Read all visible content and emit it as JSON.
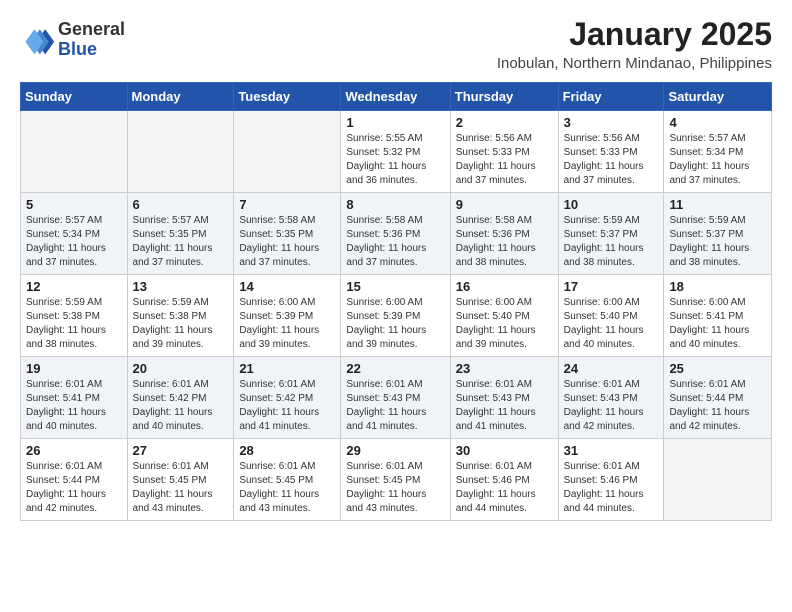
{
  "header": {
    "logo_general": "General",
    "logo_blue": "Blue",
    "month": "January 2025",
    "location": "Inobulan, Northern Mindanao, Philippines"
  },
  "weekdays": [
    "Sunday",
    "Monday",
    "Tuesday",
    "Wednesday",
    "Thursday",
    "Friday",
    "Saturday"
  ],
  "weeks": [
    [
      {
        "day": "",
        "info": ""
      },
      {
        "day": "",
        "info": ""
      },
      {
        "day": "",
        "info": ""
      },
      {
        "day": "1",
        "info": "Sunrise: 5:55 AM\nSunset: 5:32 PM\nDaylight: 11 hours and 36 minutes."
      },
      {
        "day": "2",
        "info": "Sunrise: 5:56 AM\nSunset: 5:33 PM\nDaylight: 11 hours and 37 minutes."
      },
      {
        "day": "3",
        "info": "Sunrise: 5:56 AM\nSunset: 5:33 PM\nDaylight: 11 hours and 37 minutes."
      },
      {
        "day": "4",
        "info": "Sunrise: 5:57 AM\nSunset: 5:34 PM\nDaylight: 11 hours and 37 minutes."
      }
    ],
    [
      {
        "day": "5",
        "info": "Sunrise: 5:57 AM\nSunset: 5:34 PM\nDaylight: 11 hours and 37 minutes."
      },
      {
        "day": "6",
        "info": "Sunrise: 5:57 AM\nSunset: 5:35 PM\nDaylight: 11 hours and 37 minutes."
      },
      {
        "day": "7",
        "info": "Sunrise: 5:58 AM\nSunset: 5:35 PM\nDaylight: 11 hours and 37 minutes."
      },
      {
        "day": "8",
        "info": "Sunrise: 5:58 AM\nSunset: 5:36 PM\nDaylight: 11 hours and 37 minutes."
      },
      {
        "day": "9",
        "info": "Sunrise: 5:58 AM\nSunset: 5:36 PM\nDaylight: 11 hours and 38 minutes."
      },
      {
        "day": "10",
        "info": "Sunrise: 5:59 AM\nSunset: 5:37 PM\nDaylight: 11 hours and 38 minutes."
      },
      {
        "day": "11",
        "info": "Sunrise: 5:59 AM\nSunset: 5:37 PM\nDaylight: 11 hours and 38 minutes."
      }
    ],
    [
      {
        "day": "12",
        "info": "Sunrise: 5:59 AM\nSunset: 5:38 PM\nDaylight: 11 hours and 38 minutes."
      },
      {
        "day": "13",
        "info": "Sunrise: 5:59 AM\nSunset: 5:38 PM\nDaylight: 11 hours and 39 minutes."
      },
      {
        "day": "14",
        "info": "Sunrise: 6:00 AM\nSunset: 5:39 PM\nDaylight: 11 hours and 39 minutes."
      },
      {
        "day": "15",
        "info": "Sunrise: 6:00 AM\nSunset: 5:39 PM\nDaylight: 11 hours and 39 minutes."
      },
      {
        "day": "16",
        "info": "Sunrise: 6:00 AM\nSunset: 5:40 PM\nDaylight: 11 hours and 39 minutes."
      },
      {
        "day": "17",
        "info": "Sunrise: 6:00 AM\nSunset: 5:40 PM\nDaylight: 11 hours and 40 minutes."
      },
      {
        "day": "18",
        "info": "Sunrise: 6:00 AM\nSunset: 5:41 PM\nDaylight: 11 hours and 40 minutes."
      }
    ],
    [
      {
        "day": "19",
        "info": "Sunrise: 6:01 AM\nSunset: 5:41 PM\nDaylight: 11 hours and 40 minutes."
      },
      {
        "day": "20",
        "info": "Sunrise: 6:01 AM\nSunset: 5:42 PM\nDaylight: 11 hours and 40 minutes."
      },
      {
        "day": "21",
        "info": "Sunrise: 6:01 AM\nSunset: 5:42 PM\nDaylight: 11 hours and 41 minutes."
      },
      {
        "day": "22",
        "info": "Sunrise: 6:01 AM\nSunset: 5:43 PM\nDaylight: 11 hours and 41 minutes."
      },
      {
        "day": "23",
        "info": "Sunrise: 6:01 AM\nSunset: 5:43 PM\nDaylight: 11 hours and 41 minutes."
      },
      {
        "day": "24",
        "info": "Sunrise: 6:01 AM\nSunset: 5:43 PM\nDaylight: 11 hours and 42 minutes."
      },
      {
        "day": "25",
        "info": "Sunrise: 6:01 AM\nSunset: 5:44 PM\nDaylight: 11 hours and 42 minutes."
      }
    ],
    [
      {
        "day": "26",
        "info": "Sunrise: 6:01 AM\nSunset: 5:44 PM\nDaylight: 11 hours and 42 minutes."
      },
      {
        "day": "27",
        "info": "Sunrise: 6:01 AM\nSunset: 5:45 PM\nDaylight: 11 hours and 43 minutes."
      },
      {
        "day": "28",
        "info": "Sunrise: 6:01 AM\nSunset: 5:45 PM\nDaylight: 11 hours and 43 minutes."
      },
      {
        "day": "29",
        "info": "Sunrise: 6:01 AM\nSunset: 5:45 PM\nDaylight: 11 hours and 43 minutes."
      },
      {
        "day": "30",
        "info": "Sunrise: 6:01 AM\nSunset: 5:46 PM\nDaylight: 11 hours and 44 minutes."
      },
      {
        "day": "31",
        "info": "Sunrise: 6:01 AM\nSunset: 5:46 PM\nDaylight: 11 hours and 44 minutes."
      },
      {
        "day": "",
        "info": ""
      }
    ]
  ]
}
